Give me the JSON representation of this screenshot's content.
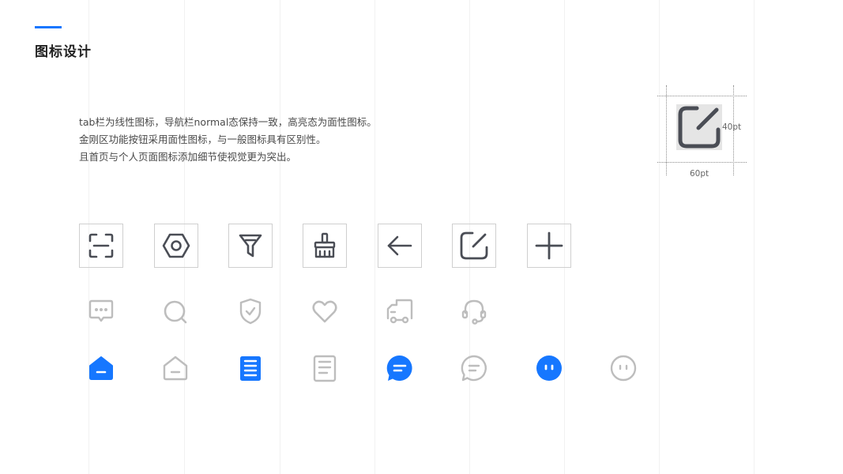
{
  "page": {
    "title": "图标设计"
  },
  "description": {
    "lines": [
      "tab栏为线性图标，导航栏normal态保持一致，高亮态为面性图标。",
      "金刚区功能按钮采用面性图标，与一般图标具有区别性。",
      "且首页与个人页面图标添加细节使视觉更为突出。"
    ]
  },
  "spec": {
    "height_label": "40pt",
    "width_label": "60pt",
    "icon": "edit-icon"
  },
  "colors": {
    "accent": "#1677ff",
    "stroke_dark": "#4a4d55",
    "stroke_gray": "#bdbdbd"
  },
  "rows": {
    "boxed": [
      "scan-icon",
      "settings-icon",
      "filter-icon",
      "brush-icon",
      "arrow-left-icon",
      "edit-icon",
      "plus-icon"
    ],
    "gray": [
      "message-icon",
      "search-icon",
      "shield-icon",
      "heart-icon",
      "truck-icon",
      "headset-icon"
    ],
    "tabbar": [
      {
        "icon": "home-icon",
        "state": "active"
      },
      {
        "icon": "home-icon",
        "state": "normal"
      },
      {
        "icon": "clipboard-icon",
        "state": "active"
      },
      {
        "icon": "clipboard-icon",
        "state": "normal"
      },
      {
        "icon": "chat-icon",
        "state": "active"
      },
      {
        "icon": "chat-icon",
        "state": "normal"
      },
      {
        "icon": "profile-icon",
        "state": "active"
      },
      {
        "icon": "profile-icon",
        "state": "normal"
      }
    ]
  }
}
